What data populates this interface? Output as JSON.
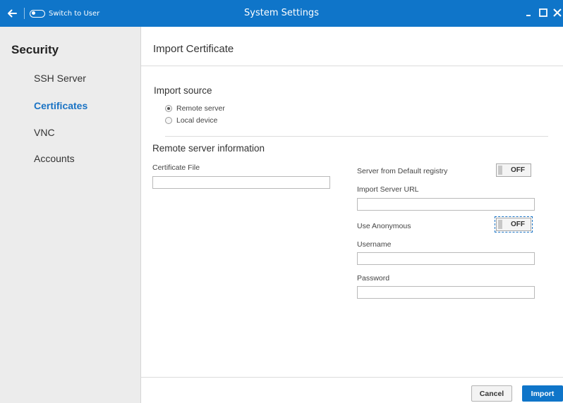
{
  "window": {
    "title": "System Settings",
    "switch_label": "Switch to User",
    "accent_color": "#0f75c9"
  },
  "sidebar": {
    "heading": "Security",
    "items": [
      {
        "label": "SSH Server",
        "active": false
      },
      {
        "label": "Certificates",
        "active": true
      },
      {
        "label": "VNC",
        "active": false
      },
      {
        "label": "Accounts",
        "active": false
      }
    ]
  },
  "page": {
    "title": "Import Certificate",
    "import_source": {
      "label": "Import source",
      "options": [
        {
          "label": "Remote server",
          "checked": true
        },
        {
          "label": "Local device",
          "checked": false
        }
      ]
    },
    "remote_server": {
      "label": "Remote server information",
      "certificate_file_label": "Certificate File",
      "certificate_file_value": "",
      "default_registry_label": "Server from Default registry",
      "default_registry_state": "OFF",
      "import_url_label": "Import Server URL",
      "import_url_value": "",
      "use_anonymous_label": "Use Anonymous",
      "use_anonymous_state": "OFF",
      "username_label": "Username",
      "username_value": "",
      "password_label": "Password",
      "password_value": ""
    }
  },
  "footer": {
    "cancel_label": "Cancel",
    "import_label": "Import"
  },
  "icons": {
    "back": "back-arrow-icon",
    "switch": "toggle-switch-icon",
    "minimize": "minimize-icon",
    "maximize": "maximize-icon",
    "close": "close-icon"
  }
}
